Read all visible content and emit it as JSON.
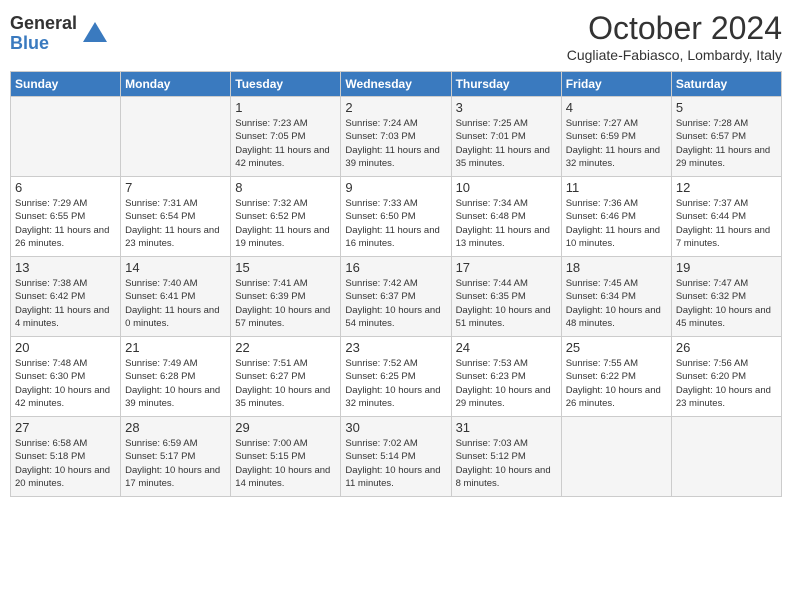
{
  "logo": {
    "general": "General",
    "blue": "Blue"
  },
  "title": "October 2024",
  "location": "Cugliate-Fabiasco, Lombardy, Italy",
  "headers": [
    "Sunday",
    "Monday",
    "Tuesday",
    "Wednesday",
    "Thursday",
    "Friday",
    "Saturday"
  ],
  "weeks": [
    [
      {
        "day": "",
        "info": ""
      },
      {
        "day": "",
        "info": ""
      },
      {
        "day": "1",
        "info": "Sunrise: 7:23 AM\nSunset: 7:05 PM\nDaylight: 11 hours and 42 minutes."
      },
      {
        "day": "2",
        "info": "Sunrise: 7:24 AM\nSunset: 7:03 PM\nDaylight: 11 hours and 39 minutes."
      },
      {
        "day": "3",
        "info": "Sunrise: 7:25 AM\nSunset: 7:01 PM\nDaylight: 11 hours and 35 minutes."
      },
      {
        "day": "4",
        "info": "Sunrise: 7:27 AM\nSunset: 6:59 PM\nDaylight: 11 hours and 32 minutes."
      },
      {
        "day": "5",
        "info": "Sunrise: 7:28 AM\nSunset: 6:57 PM\nDaylight: 11 hours and 29 minutes."
      }
    ],
    [
      {
        "day": "6",
        "info": "Sunrise: 7:29 AM\nSunset: 6:55 PM\nDaylight: 11 hours and 26 minutes."
      },
      {
        "day": "7",
        "info": "Sunrise: 7:31 AM\nSunset: 6:54 PM\nDaylight: 11 hours and 23 minutes."
      },
      {
        "day": "8",
        "info": "Sunrise: 7:32 AM\nSunset: 6:52 PM\nDaylight: 11 hours and 19 minutes."
      },
      {
        "day": "9",
        "info": "Sunrise: 7:33 AM\nSunset: 6:50 PM\nDaylight: 11 hours and 16 minutes."
      },
      {
        "day": "10",
        "info": "Sunrise: 7:34 AM\nSunset: 6:48 PM\nDaylight: 11 hours and 13 minutes."
      },
      {
        "day": "11",
        "info": "Sunrise: 7:36 AM\nSunset: 6:46 PM\nDaylight: 11 hours and 10 minutes."
      },
      {
        "day": "12",
        "info": "Sunrise: 7:37 AM\nSunset: 6:44 PM\nDaylight: 11 hours and 7 minutes."
      }
    ],
    [
      {
        "day": "13",
        "info": "Sunrise: 7:38 AM\nSunset: 6:42 PM\nDaylight: 11 hours and 4 minutes."
      },
      {
        "day": "14",
        "info": "Sunrise: 7:40 AM\nSunset: 6:41 PM\nDaylight: 11 hours and 0 minutes."
      },
      {
        "day": "15",
        "info": "Sunrise: 7:41 AM\nSunset: 6:39 PM\nDaylight: 10 hours and 57 minutes."
      },
      {
        "day": "16",
        "info": "Sunrise: 7:42 AM\nSunset: 6:37 PM\nDaylight: 10 hours and 54 minutes."
      },
      {
        "day": "17",
        "info": "Sunrise: 7:44 AM\nSunset: 6:35 PM\nDaylight: 10 hours and 51 minutes."
      },
      {
        "day": "18",
        "info": "Sunrise: 7:45 AM\nSunset: 6:34 PM\nDaylight: 10 hours and 48 minutes."
      },
      {
        "day": "19",
        "info": "Sunrise: 7:47 AM\nSunset: 6:32 PM\nDaylight: 10 hours and 45 minutes."
      }
    ],
    [
      {
        "day": "20",
        "info": "Sunrise: 7:48 AM\nSunset: 6:30 PM\nDaylight: 10 hours and 42 minutes."
      },
      {
        "day": "21",
        "info": "Sunrise: 7:49 AM\nSunset: 6:28 PM\nDaylight: 10 hours and 39 minutes."
      },
      {
        "day": "22",
        "info": "Sunrise: 7:51 AM\nSunset: 6:27 PM\nDaylight: 10 hours and 35 minutes."
      },
      {
        "day": "23",
        "info": "Sunrise: 7:52 AM\nSunset: 6:25 PM\nDaylight: 10 hours and 32 minutes."
      },
      {
        "day": "24",
        "info": "Sunrise: 7:53 AM\nSunset: 6:23 PM\nDaylight: 10 hours and 29 minutes."
      },
      {
        "day": "25",
        "info": "Sunrise: 7:55 AM\nSunset: 6:22 PM\nDaylight: 10 hours and 26 minutes."
      },
      {
        "day": "26",
        "info": "Sunrise: 7:56 AM\nSunset: 6:20 PM\nDaylight: 10 hours and 23 minutes."
      }
    ],
    [
      {
        "day": "27",
        "info": "Sunrise: 6:58 AM\nSunset: 5:18 PM\nDaylight: 10 hours and 20 minutes."
      },
      {
        "day": "28",
        "info": "Sunrise: 6:59 AM\nSunset: 5:17 PM\nDaylight: 10 hours and 17 minutes."
      },
      {
        "day": "29",
        "info": "Sunrise: 7:00 AM\nSunset: 5:15 PM\nDaylight: 10 hours and 14 minutes."
      },
      {
        "day": "30",
        "info": "Sunrise: 7:02 AM\nSunset: 5:14 PM\nDaylight: 10 hours and 11 minutes."
      },
      {
        "day": "31",
        "info": "Sunrise: 7:03 AM\nSunset: 5:12 PM\nDaylight: 10 hours and 8 minutes."
      },
      {
        "day": "",
        "info": ""
      },
      {
        "day": "",
        "info": ""
      }
    ]
  ]
}
